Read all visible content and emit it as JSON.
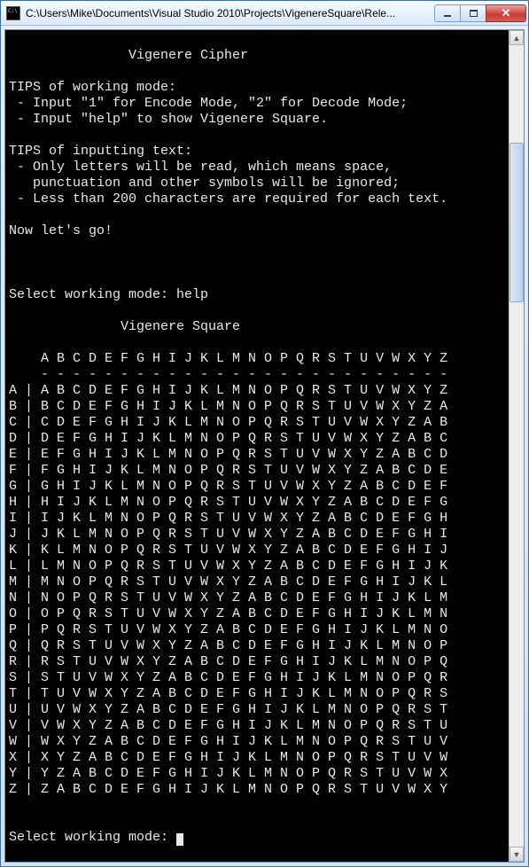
{
  "window": {
    "title": "C:\\Users\\Mike\\Documents\\Visual Studio 2010\\Projects\\VigenereSquare\\Rele..."
  },
  "console": {
    "heading": "               Vigenere Cipher",
    "tips_mode_header": "TIPS of working mode:",
    "tips_mode_1": " - Input \"1\" for Encode Mode, \"2\" for Decode Mode;",
    "tips_mode_2": " - Input \"help\" to show Vigenere Square.",
    "tips_text_header": "TIPS of inputting text:",
    "tips_text_1": " - Only letters will be read, which means space,",
    "tips_text_2": "   punctuation and other symbols will be ignored;",
    "tips_text_3": " - Less than 200 characters are required for each text.",
    "lets_go": "Now let's go!",
    "select_mode_1": "Select working mode: help",
    "square_heading": "              Vigenere Square",
    "square_header": "    A B C D E F G H I J K L M N O P Q R S T U V W X Y Z",
    "square_divider": "    - - - - - - - - - - - - - - - - - - - - - - - - - -",
    "square_rows": [
      "A | A B C D E F G H I J K L M N O P Q R S T U V W X Y Z",
      "B | B C D E F G H I J K L M N O P Q R S T U V W X Y Z A",
      "C | C D E F G H I J K L M N O P Q R S T U V W X Y Z A B",
      "D | D E F G H I J K L M N O P Q R S T U V W X Y Z A B C",
      "E | E F G H I J K L M N O P Q R S T U V W X Y Z A B C D",
      "F | F G H I J K L M N O P Q R S T U V W X Y Z A B C D E",
      "G | G H I J K L M N O P Q R S T U V W X Y Z A B C D E F",
      "H | H I J K L M N O P Q R S T U V W X Y Z A B C D E F G",
      "I | I J K L M N O P Q R S T U V W X Y Z A B C D E F G H",
      "J | J K L M N O P Q R S T U V W X Y Z A B C D E F G H I",
      "K | K L M N O P Q R S T U V W X Y Z A B C D E F G H I J",
      "L | L M N O P Q R S T U V W X Y Z A B C D E F G H I J K",
      "M | M N O P Q R S T U V W X Y Z A B C D E F G H I J K L",
      "N | N O P Q R S T U V W X Y Z A B C D E F G H I J K L M",
      "O | O P Q R S T U V W X Y Z A B C D E F G H I J K L M N",
      "P | P Q R S T U V W X Y Z A B C D E F G H I J K L M N O",
      "Q | Q R S T U V W X Y Z A B C D E F G H I J K L M N O P",
      "R | R S T U V W X Y Z A B C D E F G H I J K L M N O P Q",
      "S | S T U V W X Y Z A B C D E F G H I J K L M N O P Q R",
      "T | T U V W X Y Z A B C D E F G H I J K L M N O P Q R S",
      "U | U V W X Y Z A B C D E F G H I J K L M N O P Q R S T",
      "V | V W X Y Z A B C D E F G H I J K L M N O P Q R S T U",
      "W | W X Y Z A B C D E F G H I J K L M N O P Q R S T U V",
      "X | X Y Z A B C D E F G H I J K L M N O P Q R S T U V W",
      "Y | Y Z A B C D E F G H I J K L M N O P Q R S T U V W X",
      "Z | Z A B C D E F G H I J K L M N O P Q R S T U V W X Y"
    ],
    "select_mode_2": "Select working mode: "
  }
}
